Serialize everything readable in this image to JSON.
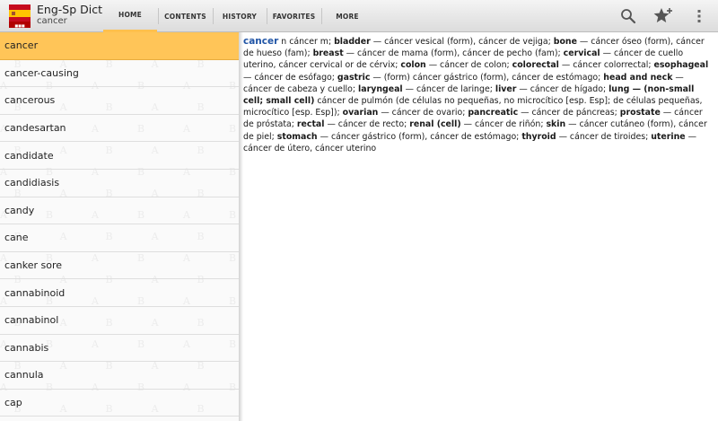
{
  "app": {
    "title": "Eng-Sp Dict",
    "subtitle": "cancer",
    "icon": "spanish-flag-dictionary-icon",
    "accent_color": "#ffc558"
  },
  "tabs": [
    {
      "label": "HOME",
      "selected": true
    },
    {
      "label": "CONTENTS",
      "selected": false
    },
    {
      "label": "HISTORY",
      "selected": false
    },
    {
      "label": "FAVORITES",
      "selected": false
    },
    {
      "label": "MORE",
      "selected": false
    }
  ],
  "actions": [
    {
      "name": "search-icon"
    },
    {
      "name": "add-favorite-icon"
    },
    {
      "name": "overflow-menu-icon"
    }
  ],
  "wordlist": {
    "selected_index": 0,
    "items": [
      "cancer",
      "cancer-causing",
      "cancerous",
      "candesartan",
      "candidate",
      "candidiasis",
      "candy",
      "cane",
      "canker sore",
      "cannabinoid",
      "cannabinol",
      "cannabis",
      "cannula",
      "cap"
    ]
  },
  "entry": {
    "headword": "cancer",
    "segments": [
      {
        "t": " n cáncer m; ",
        "b": false
      },
      {
        "t": "bladder",
        "b": true
      },
      {
        "t": " — cáncer vesical (form), cáncer de vejiga; ",
        "b": false
      },
      {
        "t": "bone",
        "b": true
      },
      {
        "t": " — cáncer óseo (form), cáncer de hueso (fam); ",
        "b": false
      },
      {
        "t": "breast",
        "b": true
      },
      {
        "t": " — cáncer de mama (form), cáncer de pecho (fam); ",
        "b": false
      },
      {
        "t": "cervical",
        "b": true
      },
      {
        "t": " — cáncer de cuello uterino, cáncer cervical or de cérvix; ",
        "b": false
      },
      {
        "t": "colon",
        "b": true
      },
      {
        "t": " — cáncer de colon; ",
        "b": false
      },
      {
        "t": "colorectal",
        "b": true
      },
      {
        "t": " — cáncer colorrectal; ",
        "b": false
      },
      {
        "t": "esophageal",
        "b": true
      },
      {
        "t": " — cáncer de esófago; ",
        "b": false
      },
      {
        "t": "gastric",
        "b": true
      },
      {
        "t": " — (form) cáncer gástrico (form), cáncer de estómago; ",
        "b": false
      },
      {
        "t": "head and neck",
        "b": true
      },
      {
        "t": " — cáncer de cabeza y cuello; ",
        "b": false
      },
      {
        "t": "laryngeal",
        "b": true
      },
      {
        "t": " — cáncer de laringe; ",
        "b": false
      },
      {
        "t": "liver",
        "b": true
      },
      {
        "t": " — cáncer de hígado; ",
        "b": false
      },
      {
        "t": "lung — (non-small cell; small cell)",
        "b": true
      },
      {
        "t": " cáncer de pulmón (de células no pequeñas, no microcítico [esp. Esp]; de células pequeñas, microcítico [esp. Esp]); ",
        "b": false
      },
      {
        "t": "ovarian",
        "b": true
      },
      {
        "t": " — cáncer de ovario; ",
        "b": false
      },
      {
        "t": "pancreatic",
        "b": true
      },
      {
        "t": " — cáncer de páncreas; ",
        "b": false
      },
      {
        "t": "prostate",
        "b": true
      },
      {
        "t": " — cáncer de próstata; ",
        "b": false
      },
      {
        "t": "rectal",
        "b": true
      },
      {
        "t": " — cáncer de recto; ",
        "b": false
      },
      {
        "t": "renal (cell)",
        "b": true
      },
      {
        "t": " — cáncer de riñón; ",
        "b": false
      },
      {
        "t": "skin",
        "b": true
      },
      {
        "t": " — cáncer cutáneo (form), cáncer de piel; ",
        "b": false
      },
      {
        "t": "stomach",
        "b": true
      },
      {
        "t": " — cáncer gástrico (form), cáncer de estómago; ",
        "b": false
      },
      {
        "t": "thyroid",
        "b": true
      },
      {
        "t": " — cáncer de tiroides; ",
        "b": false
      },
      {
        "t": "uterine",
        "b": true
      },
      {
        "t": " — cáncer de útero, cáncer uterino",
        "b": false
      }
    ]
  }
}
